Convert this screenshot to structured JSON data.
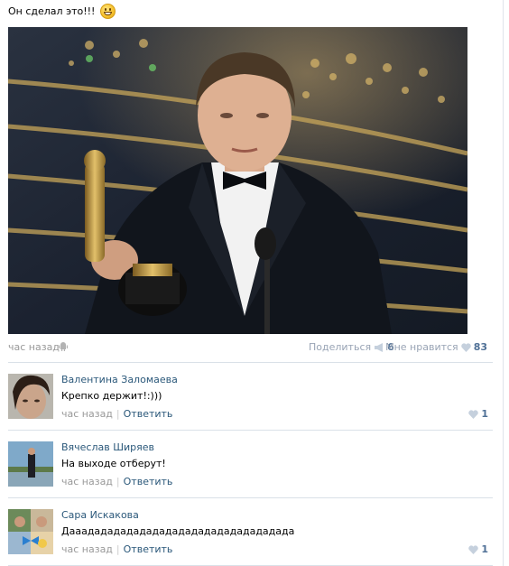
{
  "post": {
    "text": "Он сделал это!!!",
    "time": "час назад",
    "share_label": "Поделиться",
    "share_count": "6",
    "like_label": "Мне нравится",
    "like_count": "83"
  },
  "comments": [
    {
      "author": "Валентина Заломаева",
      "text": "Крепко держит!:)))",
      "time": "час назад",
      "reply": "Ответить",
      "likes": "1"
    },
    {
      "author": "Вячеслав Ширяев",
      "text": "На выходе отберут!",
      "time": "час назад",
      "reply": "Ответить",
      "likes": ""
    },
    {
      "author": "Сара Искакова",
      "text": "Дааадададададададададададададададада",
      "time": "час назад",
      "reply": "Ответить",
      "likes": "1"
    }
  ],
  "colors": {
    "link": "#2b587a",
    "muted": "#999999",
    "accent": "#4f7096",
    "separator": "#dae1e8"
  },
  "icons": [
    "smile-icon",
    "android-icon",
    "megaphone-icon",
    "heart-icon"
  ]
}
